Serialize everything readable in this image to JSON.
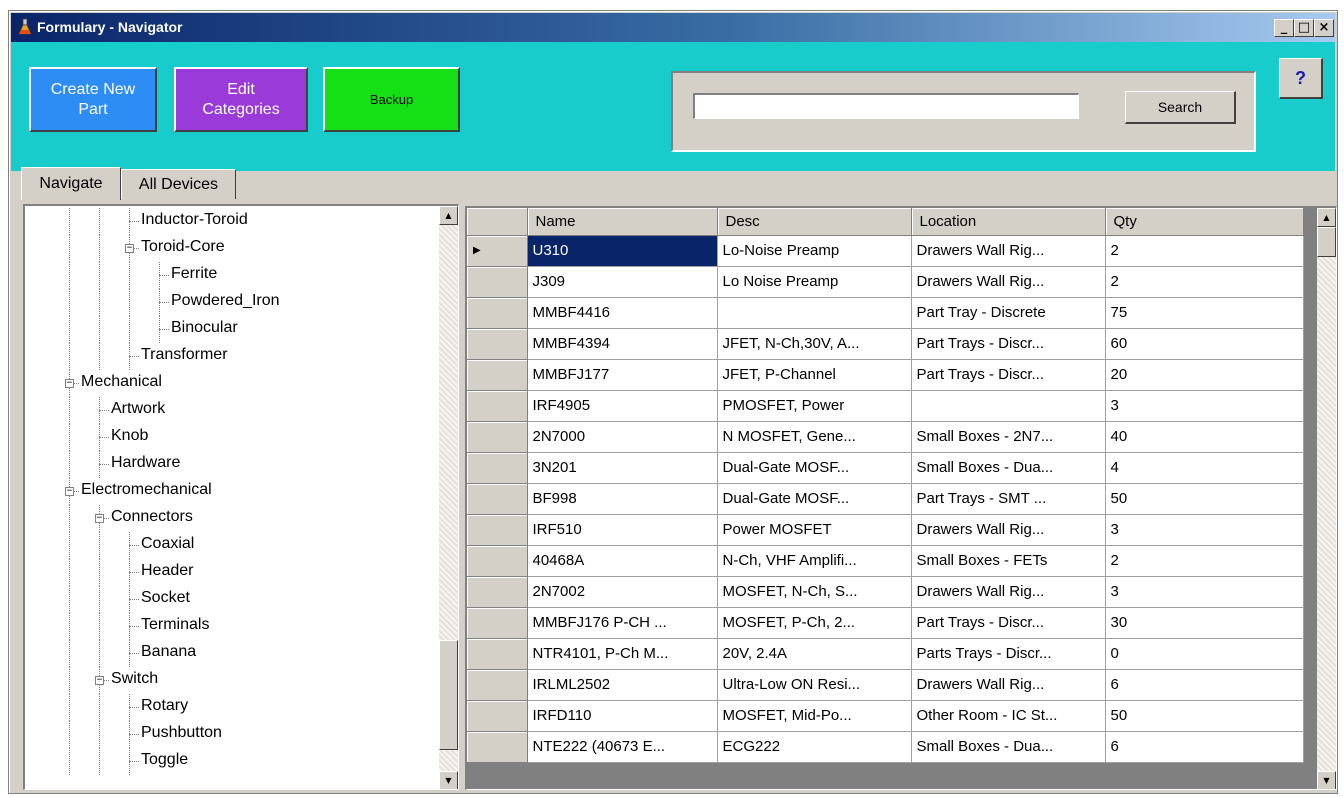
{
  "window": {
    "title": "Formulary - Navigator",
    "minimize_glyph": "_",
    "maximize_glyph": "□",
    "close_glyph": "×"
  },
  "toolbar": {
    "create_label_1": "Create New",
    "create_label_2": "Part",
    "edit_label_1": "Edit",
    "edit_label_2": "Categories",
    "backup_label": "Backup",
    "search_value": "",
    "search_label": "Search",
    "help_label": "?",
    "colors": {
      "toolbar": "#19cccc",
      "create": "#2e8cf5",
      "edit": "#9a3bd9",
      "backup": "#14e014"
    }
  },
  "tabs": {
    "navigate": "Navigate",
    "all_devices": "All Devices"
  },
  "tree": {
    "nodes": [
      {
        "label": "Inductor-Toroid",
        "level": 2,
        "expander": false
      },
      {
        "label": "Toroid-Core",
        "level": 2,
        "expander": true
      },
      {
        "label": "Ferrite",
        "level": 3,
        "expander": false
      },
      {
        "label": "Powdered_Iron",
        "level": 3,
        "expander": false
      },
      {
        "label": "Binocular",
        "level": 3,
        "expander": false
      },
      {
        "label": "Transformer",
        "level": 2,
        "expander": false
      },
      {
        "label": "Mechanical",
        "level": 0,
        "expander": true
      },
      {
        "label": "Artwork",
        "level": 1,
        "expander": false
      },
      {
        "label": "Knob",
        "level": 1,
        "expander": false
      },
      {
        "label": "Hardware",
        "level": 1,
        "expander": false
      },
      {
        "label": "Electromechanical",
        "level": 0,
        "expander": true
      },
      {
        "label": "Connectors",
        "level": 1,
        "expander": true
      },
      {
        "label": "Coaxial",
        "level": 2,
        "expander": false
      },
      {
        "label": "Header",
        "level": 2,
        "expander": false
      },
      {
        "label": "Socket",
        "level": 2,
        "expander": false
      },
      {
        "label": "Terminals",
        "level": 2,
        "expander": false
      },
      {
        "label": "Banana",
        "level": 2,
        "expander": false
      },
      {
        "label": "Switch",
        "level": 1,
        "expander": true
      },
      {
        "label": "Rotary",
        "level": 2,
        "expander": false
      },
      {
        "label": "Pushbutton",
        "level": 2,
        "expander": false
      },
      {
        "label": "Toggle",
        "level": 2,
        "expander": false
      }
    ]
  },
  "grid": {
    "columns": [
      "Name",
      "Desc",
      "Location",
      "Qty"
    ],
    "rows": [
      [
        "U310",
        "Lo-Noise Preamp",
        "Drawers Wall Rig...",
        "2"
      ],
      [
        "J309",
        "Lo Noise Preamp",
        "Drawers Wall Rig...",
        "2"
      ],
      [
        "MMBF4416",
        "",
        "Part Tray - Discrete",
        "75"
      ],
      [
        "MMBF4394",
        "JFET, N-Ch,30V, A...",
        "Part Trays - Discr...",
        "60"
      ],
      [
        "MMBFJ177",
        "JFET, P-Channel",
        "Part Trays - Discr...",
        "20"
      ],
      [
        "IRF4905",
        "PMOSFET, Power",
        "",
        "3"
      ],
      [
        "2N7000",
        "N MOSFET, Gene...",
        "Small Boxes - 2N7...",
        "40"
      ],
      [
        "3N201",
        "Dual-Gate MOSF...",
        "Small Boxes - Dua...",
        "4"
      ],
      [
        "BF998",
        "Dual-Gate MOSF...",
        "Part Trays - SMT ...",
        "50"
      ],
      [
        "IRF510",
        "Power MOSFET",
        "Drawers Wall Rig...",
        "3"
      ],
      [
        "40468A",
        "N-Ch, VHF Amplifi...",
        "Small Boxes - FETs",
        "2"
      ],
      [
        "2N7002",
        "MOSFET, N-Ch, S...",
        "Drawers Wall Rig...",
        "3"
      ],
      [
        "MMBFJ176 P-CH ...",
        "MOSFET, P-Ch, 2...",
        "Part Trays - Discr...",
        "30"
      ],
      [
        "NTR4101, P-Ch M...",
        "20V, 2.4A",
        "Parts Trays - Discr...",
        "0"
      ],
      [
        "IRLML2502",
        "Ultra-Low ON Resi...",
        "Drawers Wall Rig...",
        "6"
      ],
      [
        "IRFD110",
        "MOSFET, Mid-Po...",
        "Other Room - IC St...",
        "50"
      ],
      [
        "NTE222 (40673 E...",
        "ECG222",
        "Small Boxes - Dua...",
        "6"
      ]
    ],
    "selected_row": 0,
    "current_row_glyph": "▶"
  }
}
